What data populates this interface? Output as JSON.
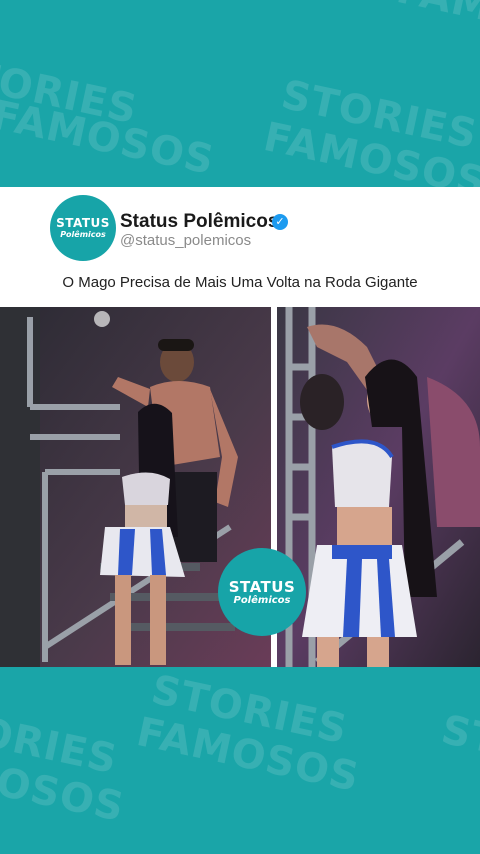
{
  "watermark": {
    "line1": "STORIES",
    "line2": "FAMOSOS"
  },
  "profile": {
    "logo_line1": "STATUS",
    "logo_line2": "Polêmicos",
    "name": "Status Polêmicos",
    "handle": "@status_polemicos",
    "verified_icon": "check-badge-icon"
  },
  "post": {
    "caption": "O Mago Precisa de Mais Uma Volta na Roda Gigante"
  },
  "overlay_logo": {
    "line1": "STATUS",
    "line2": "Polêmicos"
  },
  "colors": {
    "background": "#1aa5a8",
    "brand": "#17a4a8",
    "verified": "#1d9bf0"
  }
}
